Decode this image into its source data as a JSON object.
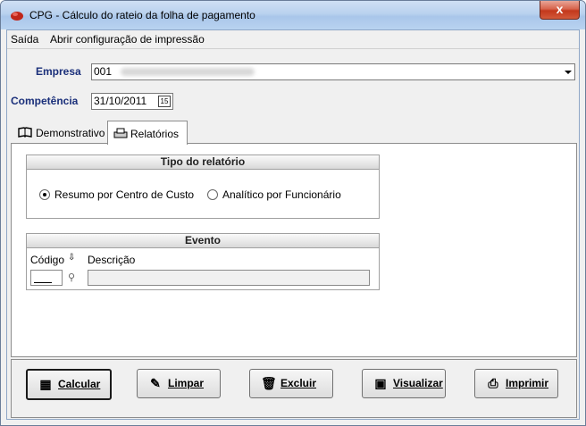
{
  "window": {
    "title": "CPG - Cálculo do rateio da folha de pagamento",
    "close_symbol": "x"
  },
  "menu": {
    "items": [
      {
        "label": "Saída"
      },
      {
        "label": "Abrir configuração de impressão"
      }
    ]
  },
  "empresa": {
    "label": "Empresa",
    "value": "001"
  },
  "competencia": {
    "label": "Competência",
    "value": "31/10/2011",
    "calendar_glyph": "15"
  },
  "tabs": [
    {
      "label": "Demonstrativo",
      "icon": "book-icon"
    },
    {
      "label": "Relatórios",
      "icon": "printer-icon"
    }
  ],
  "tipo": {
    "title": "Tipo do relatório",
    "options": [
      {
        "label": "Resumo por Centro de Custo",
        "checked": true
      },
      {
        "label": "Analítico por Funcionário",
        "checked": false
      }
    ]
  },
  "evento": {
    "title": "Evento",
    "col_codigo": "Código",
    "col_descricao": "Descrição"
  },
  "buttons": [
    {
      "label": "Calcular",
      "icon": "calculator-icon"
    },
    {
      "label": "Limpar",
      "icon": "eraser-icon"
    },
    {
      "label": "Excluir",
      "icon": "trash-icon"
    },
    {
      "label": "Visualizar",
      "icon": "monitor-icon"
    },
    {
      "label": "Imprimir",
      "icon": "printer-icon"
    }
  ]
}
